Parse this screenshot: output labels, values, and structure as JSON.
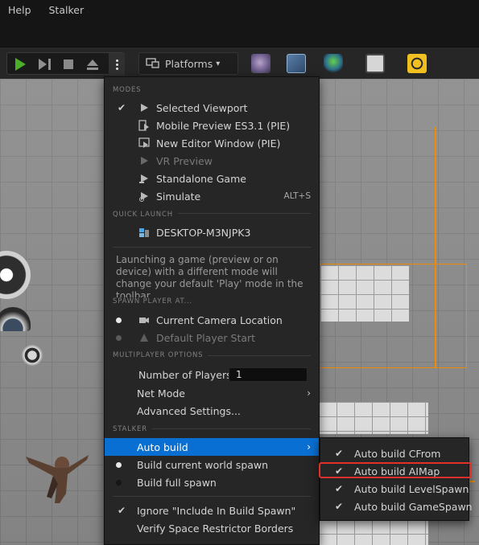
{
  "menubar": {
    "items": [
      "Help",
      "Stalker"
    ]
  },
  "toolbar": {
    "play_icon": "play-icon",
    "platforms_label": "Platforms",
    "platforms_chevron": "⌄"
  },
  "menu": {
    "sections": {
      "modes": "MODES",
      "quick_launch": "QUICK LAUNCH",
      "spawn_player": "SPAWN PLAYER AT...",
      "multiplayer": "MULTIPLAYER OPTIONS",
      "stalker": "STALKER"
    },
    "modes": [
      {
        "label": "Selected Viewport",
        "checked": true,
        "shortcut": ""
      },
      {
        "label": "Mobile Preview ES3.1 (PIE)",
        "checked": false,
        "shortcut": ""
      },
      {
        "label": "New Editor Window (PIE)",
        "checked": false,
        "shortcut": ""
      },
      {
        "label": "VR Preview",
        "checked": false,
        "shortcut": "",
        "disabled": true
      },
      {
        "label": "Standalone Game",
        "checked": false,
        "shortcut": ""
      },
      {
        "label": "Simulate",
        "checked": false,
        "shortcut": "ALT+S"
      }
    ],
    "quick_launch_device": "DESKTOP-M3NJPK3",
    "description": "Launching a game (preview or on device) with a different mode will change your default 'Play' mode in the toolbar",
    "spawn": [
      {
        "label": "Current Camera Location",
        "selected": true
      },
      {
        "label": "Default Player Start",
        "selected": false,
        "disabled": true
      }
    ],
    "multiplayer": {
      "num_players_label": "Number of Players",
      "num_players_value": "1",
      "net_mode_label": "Net Mode",
      "advanced_label": "Advanced Settings..."
    },
    "stalker": {
      "auto_build": "Auto build",
      "build_current": "Build current world spawn",
      "build_full": "Build full spawn",
      "ignore": "Ignore \"Include In Build Spawn\"",
      "verify": "Verify Space Restrictor Borders"
    }
  },
  "submenu": {
    "items": [
      {
        "label": "Auto build CFrom",
        "checked": true
      },
      {
        "label": "Auto build AIMap",
        "checked": true,
        "highlighted": true
      },
      {
        "label": "Auto build LevelSpawn",
        "checked": true
      },
      {
        "label": "Auto build GameSpawn",
        "checked": true
      }
    ]
  },
  "colors": {
    "accent": "#0a6fd2",
    "highlight_box": "#e0302a",
    "play": "#4caf2a"
  }
}
